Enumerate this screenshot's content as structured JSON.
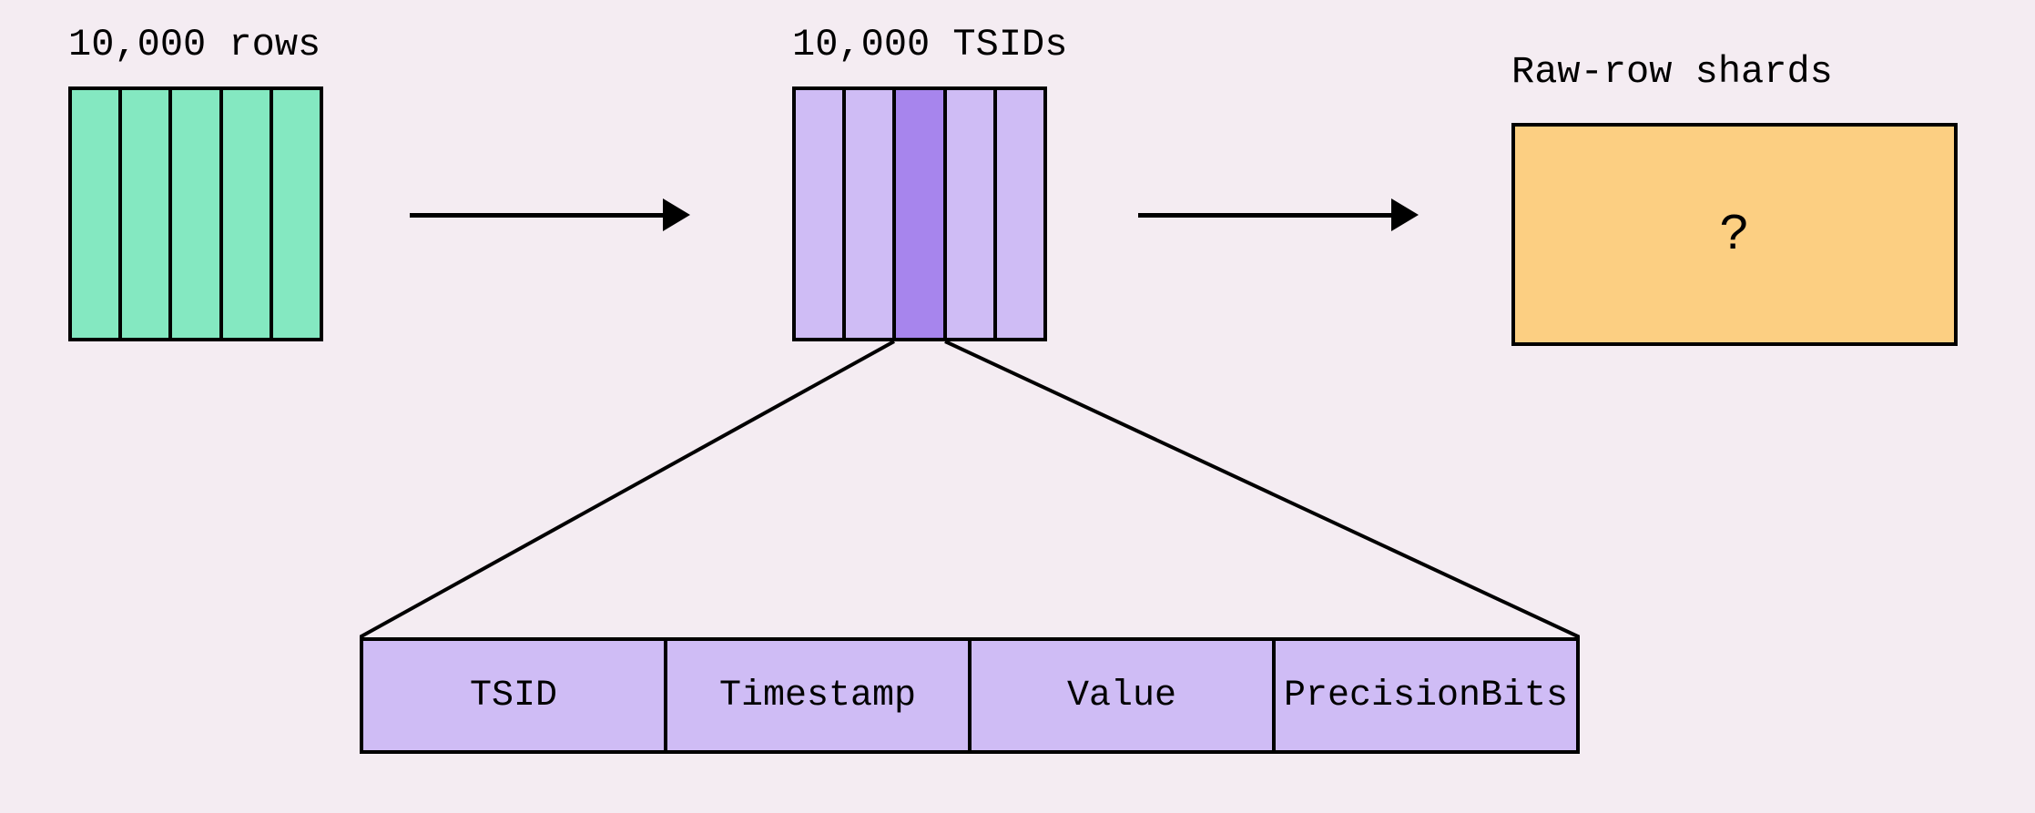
{
  "labels": {
    "rows": "10,000 rows",
    "tsids": "10,000 TSIDs",
    "shards": "Raw-row shards",
    "unknown": "?"
  },
  "detail_fields": [
    "TSID",
    "Timestamp",
    "Value",
    "PrecisionBits"
  ],
  "colors": {
    "background": "#f4ecf2",
    "green": "#84e8c1",
    "purple_light": "#cfbcf5",
    "purple_dark": "#a785ed",
    "orange": "#fccf82",
    "stroke": "#000000"
  }
}
